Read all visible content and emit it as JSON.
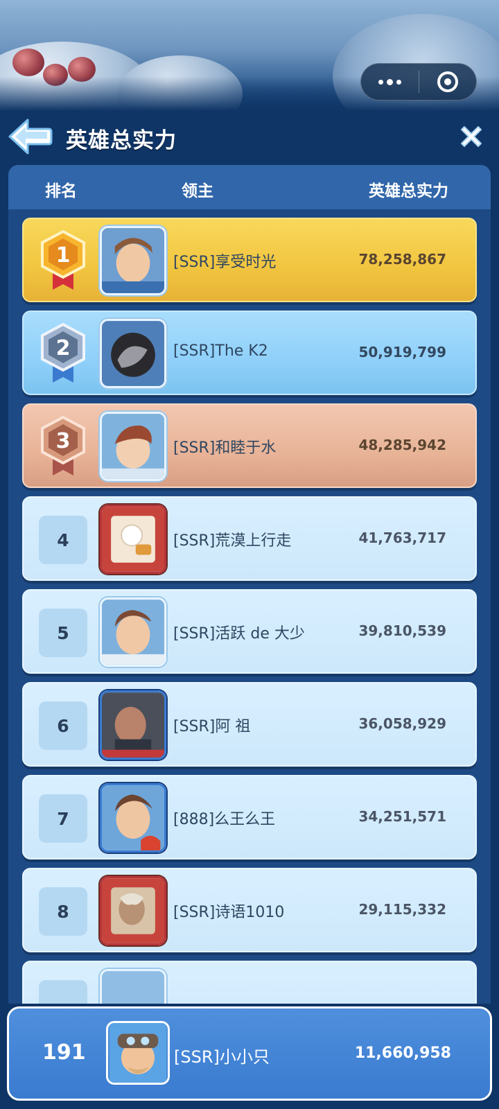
{
  "header": {
    "title": "英雄总实力"
  },
  "capsule": {
    "more_icon": "more-dots-icon",
    "close_icon": "target-icon"
  },
  "table": {
    "columns": [
      "排名",
      "领主",
      "英雄总实力"
    ],
    "rows": [
      {
        "rank": "1",
        "medal": "gold-medal-icon",
        "name": "[SSR]享受时光",
        "power": "78,258,867",
        "style": "gold"
      },
      {
        "rank": "2",
        "medal": "silver-medal-icon",
        "name": "[SSR]The K2",
        "power": "50,919,799",
        "style": "silver"
      },
      {
        "rank": "3",
        "medal": "bronze-medal-icon",
        "name": "[SSR]和睦于水",
        "power": "48,285,942",
        "style": "bronze"
      },
      {
        "rank": "4",
        "name": "[SSR]荒漠上行走",
        "power": "41,763,717",
        "style": "plain"
      },
      {
        "rank": "5",
        "name": "[SSR]活跃 de 大少",
        "power": "39,810,539",
        "style": "plain"
      },
      {
        "rank": "6",
        "name": "[SSR]阿 祖",
        "power": "36,058,929",
        "style": "plain"
      },
      {
        "rank": "7",
        "name": "[888]么王么王",
        "power": "34,251,571",
        "style": "plain"
      },
      {
        "rank": "8",
        "name": "[SSR]诗语1010",
        "power": "29,115,332",
        "style": "plain"
      }
    ]
  },
  "self": {
    "rank": "191",
    "name": "[SSR]小小只",
    "power": "11,660,958"
  },
  "colors": {
    "background": "#0f3566",
    "panel": "#1d4a85",
    "header_bar": "#3166aa",
    "gold_row": "#f1c53f",
    "silver_row": "#8fd0fa",
    "bronze_row": "#e8b397",
    "plain_row": "#cde8fb",
    "self_bar": "#3a7bd0"
  }
}
